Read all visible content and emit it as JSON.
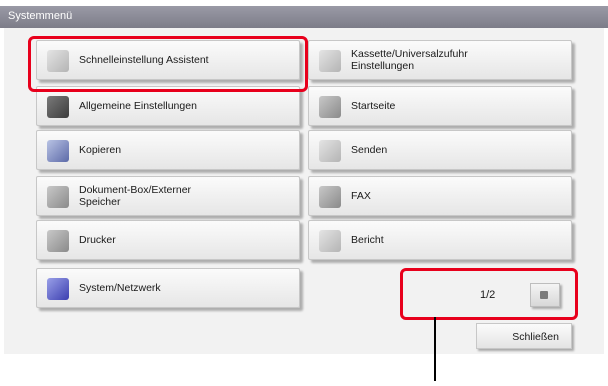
{
  "window": {
    "title": "Systemmenü"
  },
  "menu": {
    "left": [
      {
        "label": "Schnelleinstellung Assistent",
        "icon": "wizard-icon"
      },
      {
        "label": "Allgemeine Einstellungen",
        "icon": "settings-icon"
      },
      {
        "label": "Kopieren",
        "icon": "copy-icon"
      },
      {
        "label": "Dokument-Box/Externer\nSpeicher",
        "icon": "document-box-icon"
      },
      {
        "label": "Drucker",
        "icon": "printer-icon"
      },
      {
        "label": "System/Netzwerk",
        "icon": "network-icon"
      }
    ],
    "right": [
      {
        "label": "Kassette/Universalzufuhr\nEinstellungen",
        "icon": "cassette-icon"
      },
      {
        "label": "Startseite",
        "icon": "home-icon"
      },
      {
        "label": "Senden",
        "icon": "send-icon"
      },
      {
        "label": "FAX",
        "icon": "fax-icon"
      },
      {
        "label": "Bericht",
        "icon": "report-icon"
      }
    ]
  },
  "pager": {
    "text": "1/2"
  },
  "footer": {
    "close_label": "Schließen"
  },
  "colors": {
    "highlight": "#e8001c",
    "titlebar": "#8a8a96"
  }
}
